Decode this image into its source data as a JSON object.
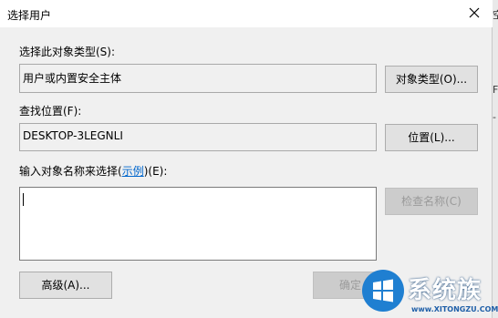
{
  "dialog": {
    "title": "选择用户",
    "object_type_label": "选择此对象类型(S):",
    "object_type_value": "用户或内置安全主体",
    "object_types_button": "对象类型(O)...",
    "location_label": "查找位置(F):",
    "location_value": "DESKTOP-3LEGNLI",
    "locations_button": "位置(L)...",
    "names_label_prefix": "输入对象名称来选择(",
    "names_label_link": "示例",
    "names_label_suffix": ")(E):",
    "names_value": "",
    "check_names_button": "检查名称(C)",
    "advanced_button": "高级(A)...",
    "ok_button": "确定"
  },
  "background_edge": {
    "right_text_1": "空",
    "right_text_2": "F",
    "right_text_3": "-"
  },
  "watermark": {
    "name": "系统族",
    "url": "www.XITONGZU.COM"
  }
}
